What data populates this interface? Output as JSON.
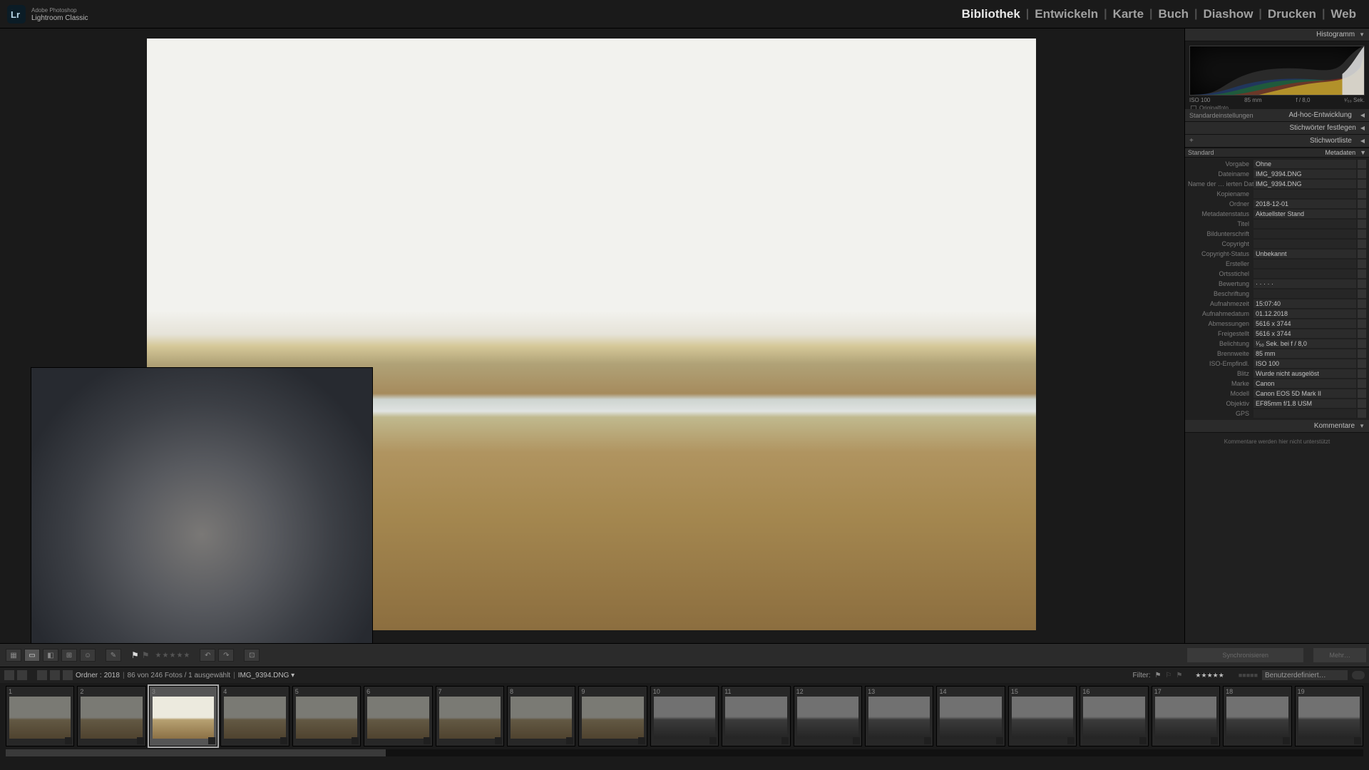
{
  "app": {
    "brand_small": "Adobe Photoshop",
    "brand": "Lightroom Classic"
  },
  "modules": [
    {
      "label": "Bibliothek",
      "active": true
    },
    {
      "label": "Entwickeln"
    },
    {
      "label": "Karte"
    },
    {
      "label": "Buch"
    },
    {
      "label": "Diashow"
    },
    {
      "label": "Drucken"
    },
    {
      "label": "Web"
    }
  ],
  "panels": {
    "histogram": {
      "title": "Histogramm",
      "iso": "ISO 100",
      "focal": "85 mm",
      "aperture": "f / 8,0",
      "shutter": "¹⁄₅₀ Sek.",
      "original_label": "Originalfoto"
    },
    "adhoc": {
      "title": "Ad-hoc-Entwicklung",
      "preset_label": "Standardeinstellungen"
    },
    "keywording": {
      "title": "Stichwörter festlegen"
    },
    "keywordlist": {
      "title": "Stichwortliste",
      "plus": "+"
    },
    "metadata": {
      "title": "Metadaten",
      "preset_row": "Standard",
      "rows": [
        {
          "k": "Vorgabe",
          "v": "Ohne"
        },
        {
          "k": "Dateiname",
          "v": "IMG_9394.DNG"
        },
        {
          "k": "Name der … ierten Datei",
          "v": "IMG_9394.DNG"
        },
        {
          "k": "Kopiename",
          "v": ""
        },
        {
          "k": "Ordner",
          "v": "2018-12-01"
        },
        {
          "k": "Metadatenstatus",
          "v": "Aktuellster Stand"
        },
        {
          "k": "Titel",
          "v": ""
        },
        {
          "k": "Bildunterschrift",
          "v": ""
        },
        {
          "k": "Copyright",
          "v": ""
        },
        {
          "k": "Copyright-Status",
          "v": "Unbekannt"
        },
        {
          "k": "Ersteller",
          "v": ""
        },
        {
          "k": "Ortsstichel",
          "v": ""
        },
        {
          "k": "Bewertung",
          "v": "· · · · ·"
        },
        {
          "k": "Beschriftung",
          "v": ""
        },
        {
          "k": "Aufnahmezeit",
          "v": "15:07:40"
        },
        {
          "k": "Aufnahmedatum",
          "v": "01.12.2018"
        },
        {
          "k": "Abmessungen",
          "v": "5616 x 3744"
        },
        {
          "k": "Freigestellt",
          "v": "5616 x 3744"
        },
        {
          "k": "Belichtung",
          "v": "¹⁄₅₀ Sek. bei f / 8,0"
        },
        {
          "k": "Brennweite",
          "v": "85 mm"
        },
        {
          "k": "ISO-Empfindl.",
          "v": "ISO 100"
        },
        {
          "k": "Blitz",
          "v": "Wurde nicht ausgelöst"
        },
        {
          "k": "Marke",
          "v": "Canon"
        },
        {
          "k": "Modell",
          "v": "Canon EOS 5D Mark II"
        },
        {
          "k": "Objektiv",
          "v": "EF85mm f/1.8 USM"
        },
        {
          "k": "GPS",
          "v": ""
        }
      ]
    },
    "comments": {
      "title": "Kommentare",
      "body": "Kommentare werden hier nicht unterstützt"
    }
  },
  "toolbar_right": {
    "sync": "Synchronisieren",
    "more": "Mehr…"
  },
  "status": {
    "folder_label": "Ordner :",
    "folder": "2018",
    "count": "86 von 246 Fotos / 1 ausgewählt",
    "file": "IMG_9394.DNG ▾",
    "filter_label": "Filter:",
    "custom": "Benutzerdefiniert…"
  },
  "film": {
    "thumbs": [
      {
        "n": "1",
        "mono": false,
        "dim": true
      },
      {
        "n": "2",
        "mono": false,
        "dim": true
      },
      {
        "n": "3",
        "mono": false,
        "sel": true
      },
      {
        "n": "4",
        "mono": false,
        "dim": true
      },
      {
        "n": "5",
        "mono": false,
        "dim": true
      },
      {
        "n": "6",
        "mono": false,
        "dim": true
      },
      {
        "n": "7",
        "mono": false,
        "dim": true
      },
      {
        "n": "8",
        "mono": false,
        "dim": true
      },
      {
        "n": "9",
        "mono": false,
        "dim": true
      },
      {
        "n": "10",
        "mono": true,
        "dim": true
      },
      {
        "n": "11",
        "mono": true,
        "dim": true
      },
      {
        "n": "12",
        "mono": true,
        "dim": true
      },
      {
        "n": "13",
        "mono": true,
        "dim": true
      },
      {
        "n": "14",
        "mono": true,
        "dim": true
      },
      {
        "n": "15",
        "mono": true,
        "dim": true
      },
      {
        "n": "16",
        "mono": true,
        "dim": true
      },
      {
        "n": "17",
        "mono": true,
        "dim": true
      },
      {
        "n": "18",
        "mono": true,
        "dim": true
      },
      {
        "n": "19",
        "mono": true,
        "dim": true
      }
    ]
  }
}
